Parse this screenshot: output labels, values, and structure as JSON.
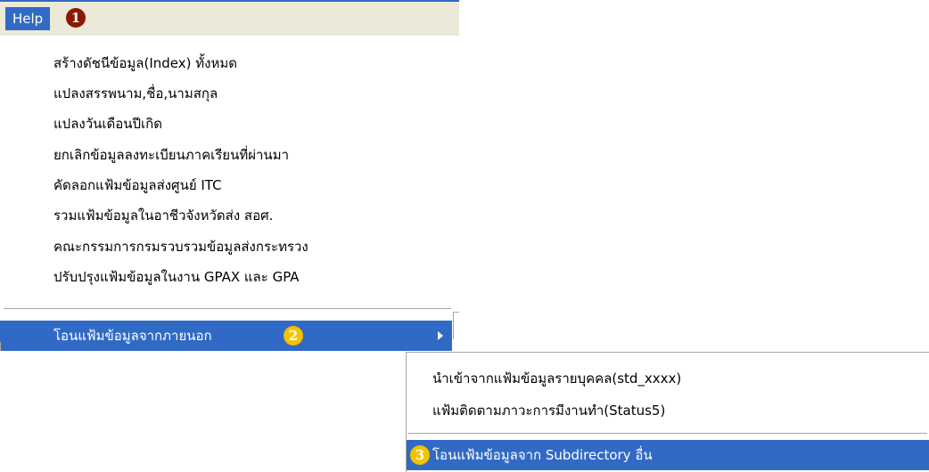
{
  "menubar": {
    "help_label": "Help",
    "badge1": "1"
  },
  "menu": {
    "items": [
      "สร้างดัชนีข้อมูล(Index) ทั้งหมด",
      "แปลงสรรพนาม,ชื่อ,นามสกุล",
      "แปลงวันเดือนปีเกิด",
      "ยกเลิกข้อมูลลงทะเบียนภาคเรียนที่ผ่านมา",
      "คัดลอกแฟ้มข้อมูลส่งศูนย์ ITC",
      "รวมแฟ้มข้อมูลในอาชีวจังหวัดส่ง สอศ.",
      "คณะกรรมการกรมรวบรวมข้อมูลส่งกระทรวง",
      "ปรับปรุงแฟ้มข้อมูลในงาน GPAX และ GPA"
    ],
    "highlighted": {
      "label": "โอนแฟ้มข้อมูลจากภายนอก",
      "badge": "2"
    }
  },
  "submenu": {
    "items": [
      "นำเข้าจากแฟ้มข้อมูลรายบุคคล(std_xxxx)",
      "แฟ้มติดตามภาวะการมีงานทำ(Status5)"
    ],
    "highlighted": {
      "label": "โอนแฟ้มข้อมูลจาก Subdirectory อื่น",
      "badge": "3"
    }
  },
  "colors": {
    "highlight": "#316ac5",
    "menubar": "#ece9d8",
    "badge_dark": "#8b1a00",
    "badge_yellow": "#f4c400"
  }
}
